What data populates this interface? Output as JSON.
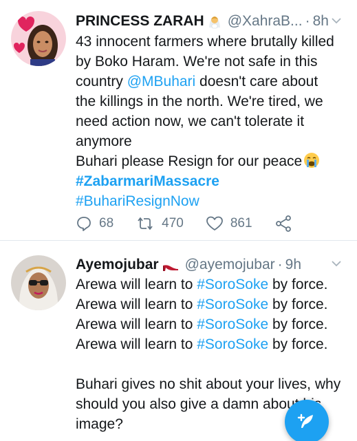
{
  "tweets": [
    {
      "name": "PRINCESS ZARAH",
      "name_emoji": "bride-emoji",
      "handle": "@XahraB...",
      "separator": "·",
      "time": "8h",
      "lines": [
        [
          "43 innocent farmers where brutally killed"
        ],
        [
          "by Boko Haram. We're not safe in this"
        ],
        [
          "country ",
          "@MBuhari",
          " doesn't care about"
        ],
        [
          "the killings in the north. We're tired, we"
        ],
        [
          "need action now, we can't tolerate it"
        ],
        [
          "anymore"
        ],
        [
          "Buhari please Resign for our peace"
        ],
        [
          "#ZabarmariMassacre"
        ],
        [
          "#BuhariResignNow"
        ]
      ],
      "mention": "@MBuhari",
      "hashtag1": "#ZabarmariMassacre",
      "hashtag2": "#BuhariResignNow",
      "replies": "68",
      "retweets": "470",
      "likes": "861"
    },
    {
      "name": "Ayemojubar",
      "name_emoji": "high-heel-emoji",
      "handle": "@ayemojubar",
      "separator": "·",
      "time": "9h",
      "line_prefix": "Arewa will learn to ",
      "line_hashtag": "#SoroSoke",
      "line_suffix": " by force.",
      "line5": "Buhari gives no shit about your lives, why",
      "line6": "should you also give a damn about his",
      "line7": "image?"
    }
  ],
  "colors": {
    "link": "#1da1f2",
    "muted": "#657786",
    "fab": "#1da1f2"
  },
  "icons": [
    "reply-icon",
    "retweet-icon",
    "like-icon",
    "share-icon",
    "chevron-down-icon",
    "compose-tweet-icon"
  ]
}
